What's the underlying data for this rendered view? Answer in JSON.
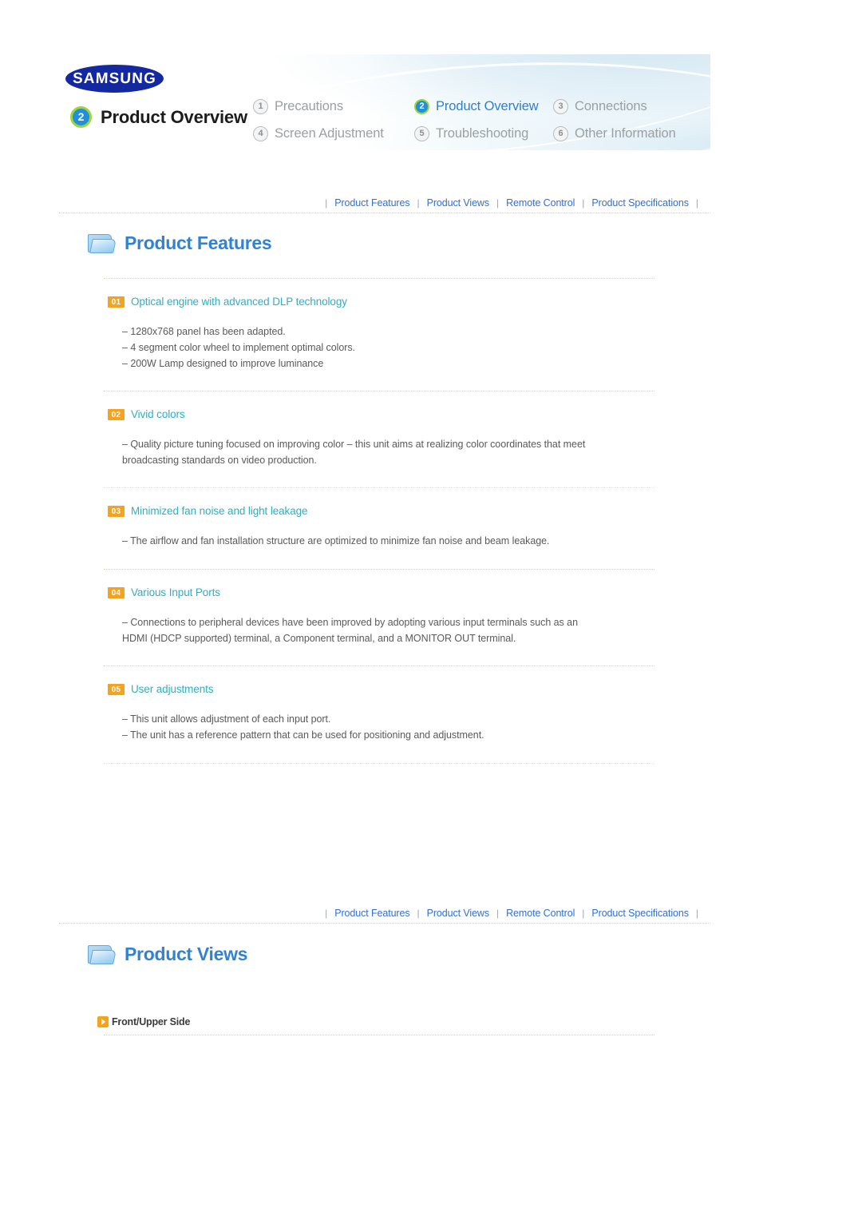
{
  "header": {
    "brand": "SAMSUNG",
    "chapter_number": "2",
    "chapter_title": "Product Overview",
    "nav": [
      {
        "num": "1",
        "label": "Precautions",
        "active": false
      },
      {
        "num": "2",
        "label": "Product Overview",
        "active": true
      },
      {
        "num": "3",
        "label": "Connections",
        "active": false
      },
      {
        "num": "4",
        "label": "Screen Adjustment",
        "active": false
      },
      {
        "num": "5",
        "label": "Troubleshooting",
        "active": false
      },
      {
        "num": "6",
        "label": "Other Information",
        "active": false
      }
    ]
  },
  "crumbs": [
    "Product Features",
    "Product Views",
    "Remote Control",
    "Product Specifications"
  ],
  "sections": {
    "product_features": {
      "icon": "folder-icon",
      "title": "Product Features"
    },
    "product_views": {
      "icon": "folder-icon",
      "title": "Product Views",
      "subhead": {
        "icon": "orange-arrow-icon",
        "label": "Front/Upper Side"
      }
    }
  },
  "features": [
    {
      "num": "01",
      "title": "Optical engine with advanced DLP technology",
      "lines": [
        "– 1280x768 panel has been adapted.",
        "– 4 segment color wheel to implement optimal colors.",
        "– 200W Lamp designed to improve luminance"
      ]
    },
    {
      "num": "02",
      "title": "Vivid colors",
      "lines": [
        "– Quality picture tuning focused on improving color – this unit aims at realizing color coordinates that meet broadcasting standards on video production."
      ]
    },
    {
      "num": "03",
      "title": "Minimized fan noise and light leakage",
      "lines": [
        "– The airflow and fan installation structure are optimized to minimize fan noise and beam leakage."
      ]
    },
    {
      "num": "04",
      "title": "Various Input Ports",
      "lines": [
        "– Connections to peripheral devices have been improved by adopting various input terminals such as an HDMI (HDCP supported) terminal, a Component terminal, and a MONITOR OUT terminal."
      ]
    },
    {
      "num": "05",
      "title": "User adjustments",
      "lines": [
        "– This unit allows adjustment of each input port.",
        "– The unit has a reference pattern that can be used for positioning and adjustment."
      ]
    }
  ],
  "colors": {
    "accent_blue": "#2f6fd8",
    "heading_blue": "#3182d4",
    "feature_title": "#2eafc4",
    "badge_orange": "#f5a31e",
    "samsung_blue": "#1428a0",
    "chapter_ring_green": "#9ed43c"
  }
}
